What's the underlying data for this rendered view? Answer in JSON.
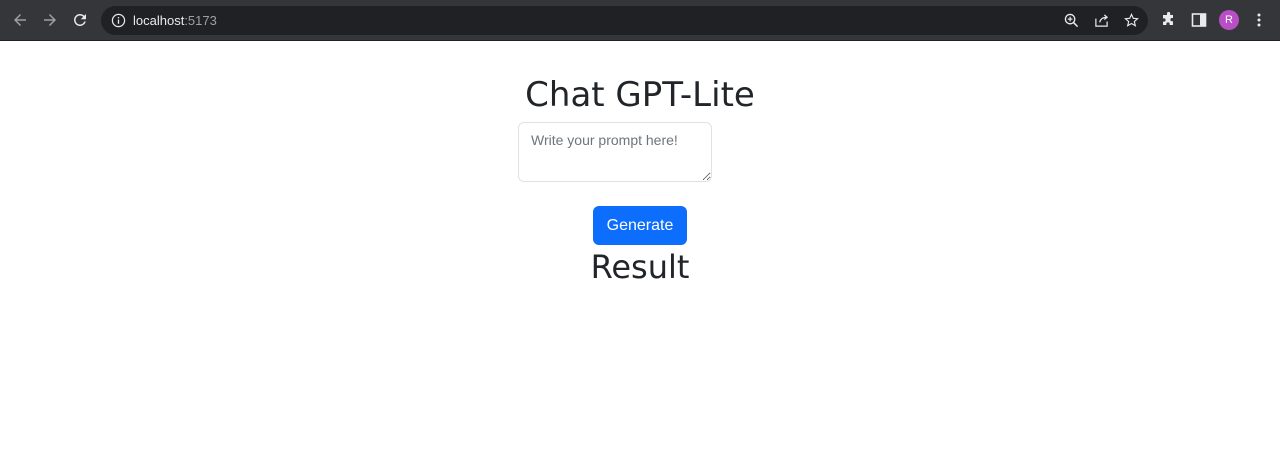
{
  "browser": {
    "url_host": "localhost",
    "url_port": ":5173",
    "profile_initial": "R"
  },
  "icons": {
    "back": "arrow-left-icon",
    "forward": "arrow-right-icon",
    "reload": "reload-icon",
    "site_info": "info-icon",
    "zoom": "zoom-icon",
    "share": "share-icon",
    "bookmark": "star-icon",
    "extensions": "puzzle-icon",
    "side_panel": "side-panel-icon",
    "menu": "kebab-menu-icon"
  },
  "colors": {
    "toolbar_bg": "#35363a",
    "omnibox_bg": "#202124",
    "primary_button": "#0d6efd",
    "avatar": "#b84fc6"
  },
  "page": {
    "title": "Chat GPT-Lite",
    "prompt": {
      "placeholder": "Write your prompt here!",
      "value": ""
    },
    "generate_label": "Generate",
    "result_heading": "Result"
  }
}
